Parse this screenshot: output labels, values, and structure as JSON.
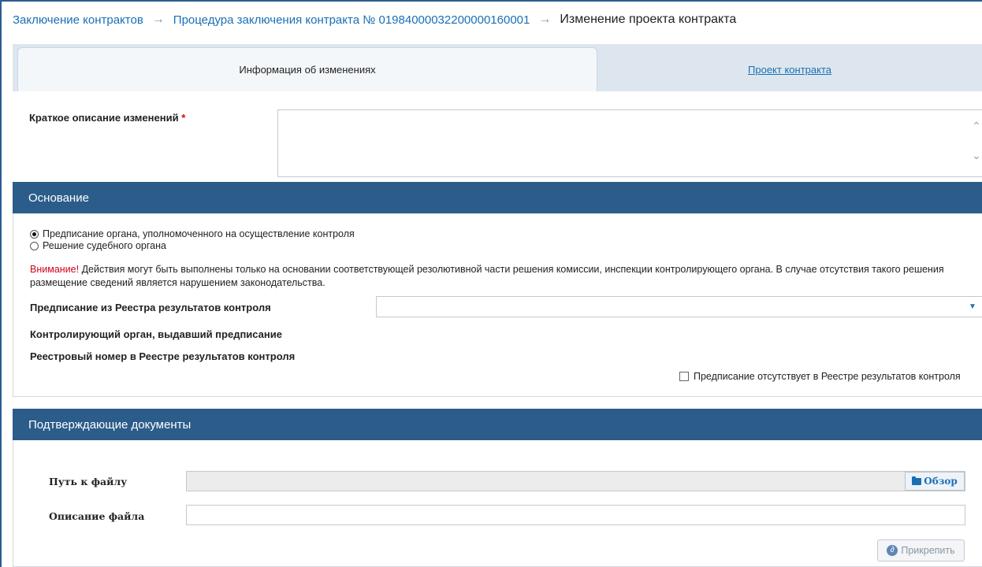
{
  "breadcrumb": {
    "item1": "Заключение контрактов",
    "item2": "Процедура заключения контракта № 01984000032200000160001",
    "current": "Изменение проекта контракта"
  },
  "tabs": {
    "active": "Информация об изменениях",
    "inactive": "Проект контракта"
  },
  "changes": {
    "label": "Краткое описание изменений",
    "required_mark": "*",
    "value": ""
  },
  "basis": {
    "title": "Основание",
    "options": [
      {
        "label": "Предписание органа, уполномоченного на осуществление контроля",
        "selected": true
      },
      {
        "label": "Решение судебного органа",
        "selected": false
      }
    ],
    "warning_prefix": "Внимание!",
    "warning_text": " Действия могут быть выполнены только на основании соответствующей резолютивной части решения комиссии, инспекции контролирующего органа. В случае отсутствия такого решения размещение сведений является нарушением законодательства.",
    "registry_label": "Предписание из Реестра результатов контроля",
    "registry_value": "",
    "authority_label": "Контролирующий орган, выдавший предписание",
    "regnum_label": "Реестровый номер в Реестре результатов контроля",
    "absent_checkbox_label": "Предписание отсутствует в Реестре результатов контроля",
    "absent_checked": false
  },
  "documents": {
    "title": "Подтверждающие документы",
    "path_label": "Путь к файлу",
    "path_value": "",
    "browse_label": "Обзор",
    "description_label": "Описание файла",
    "description_value": "",
    "attach_label": "Прикрепить"
  },
  "colors": {
    "accent": "#2b5c8a",
    "link": "#1a6fb5",
    "warning": "#d0021b"
  }
}
